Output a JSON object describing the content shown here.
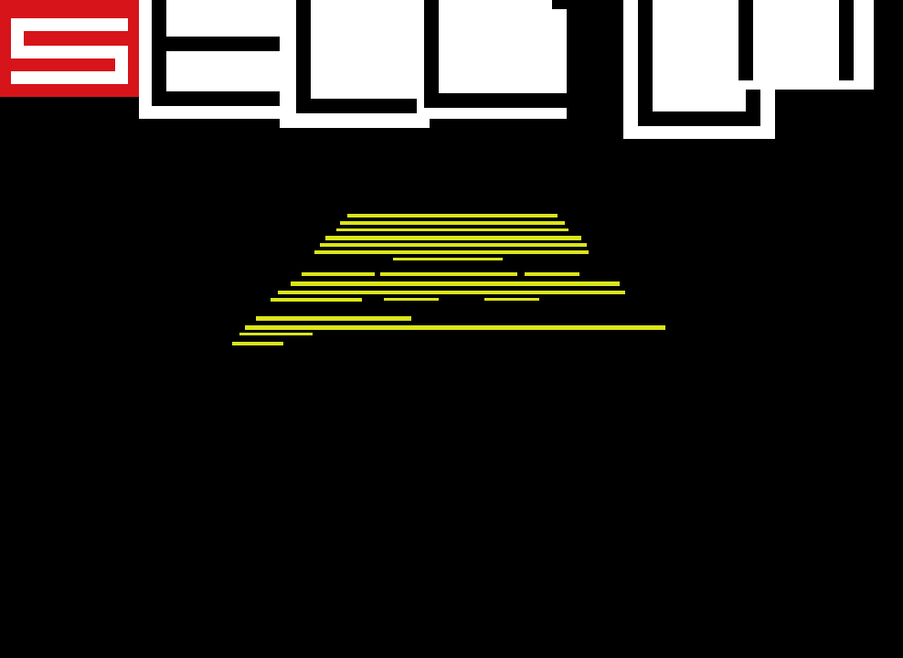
{
  "scene": {
    "background": "#000000",
    "title": {
      "text": "SECCI",
      "letters": [
        "S",
        "E",
        "C",
        "C",
        "I"
      ],
      "accent_color": "#d7141a",
      "letter_color": "#ffffff"
    },
    "crawl": {
      "color": "#e6f21a",
      "lines": [
        "",
        "",
        "",
        "",
        ""
      ]
    }
  }
}
